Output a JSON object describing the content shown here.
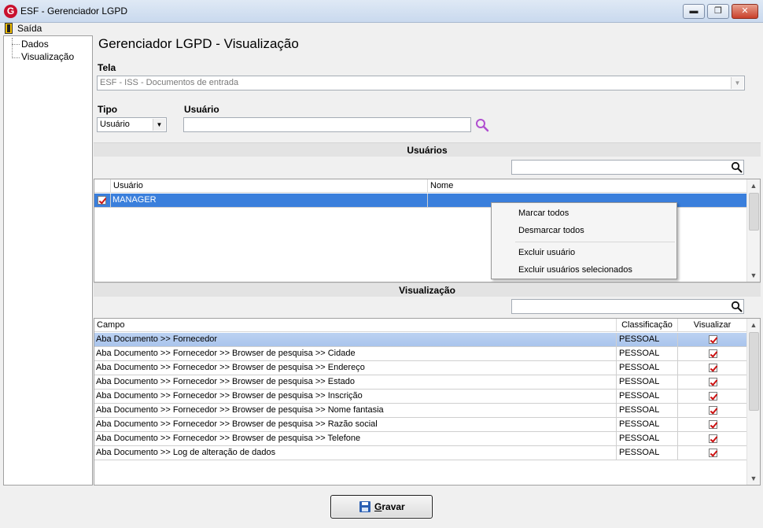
{
  "window": {
    "title": "ESF - Gerenciador LGPD",
    "icon_letter": "G",
    "min_glyph": "▬",
    "max_glyph": "❐",
    "close_glyph": "✕"
  },
  "menu": {
    "exit_label": "Saída"
  },
  "tree": {
    "items": [
      {
        "label": "Dados"
      },
      {
        "label": "Visualização"
      }
    ]
  },
  "header": {
    "title": "Gerenciador LGPD - Visualização"
  },
  "tela": {
    "label": "Tela",
    "value": "ESF - ISS - Documentos de entrada"
  },
  "tipo": {
    "label": "Tipo",
    "value": "Usuário"
  },
  "usuario": {
    "label": "Usuário",
    "value": ""
  },
  "users_section": {
    "title": "Usuários",
    "search_value": "",
    "columns": [
      "Usuário",
      "Nome"
    ],
    "rows": [
      {
        "checked": true,
        "usuario": "MANAGER",
        "nome": ""
      }
    ]
  },
  "context_menu": {
    "items": [
      "Marcar todos",
      "Desmarcar todos",
      "Excluir usuário",
      "Excluir usuários selecionados"
    ]
  },
  "visual_section": {
    "title": "Visualização",
    "search_value": "",
    "columns": [
      "Campo",
      "Classificação",
      "Visualizar"
    ],
    "rows": [
      {
        "campo": "Aba Documento >> Fornecedor",
        "classificacao": "PESSOAL",
        "visualizar": true
      },
      {
        "campo": "Aba Documento >> Fornecedor >> Browser de pesquisa >> Cidade",
        "classificacao": "PESSOAL",
        "visualizar": true
      },
      {
        "campo": "Aba Documento >> Fornecedor >> Browser de pesquisa >> Endereço",
        "classificacao": "PESSOAL",
        "visualizar": true
      },
      {
        "campo": "Aba Documento >> Fornecedor >> Browser de pesquisa >> Estado",
        "classificacao": "PESSOAL",
        "visualizar": true
      },
      {
        "campo": "Aba Documento >> Fornecedor >> Browser de pesquisa >> Inscrição",
        "classificacao": "PESSOAL",
        "visualizar": true
      },
      {
        "campo": "Aba Documento >> Fornecedor >> Browser de pesquisa >> Nome fantasia",
        "classificacao": "PESSOAL",
        "visualizar": true
      },
      {
        "campo": "Aba Documento >> Fornecedor >> Browser de pesquisa >> Razão social",
        "classificacao": "PESSOAL",
        "visualizar": true
      },
      {
        "campo": "Aba Documento >> Fornecedor >> Browser de pesquisa >> Telefone",
        "classificacao": "PESSOAL",
        "visualizar": true
      },
      {
        "campo": "Aba Documento >> Log de alteração de dados",
        "classificacao": "PESSOAL",
        "visualizar": true
      }
    ]
  },
  "actions": {
    "save_label": "Gravar"
  },
  "colors": {
    "selection": "#3a7fdc",
    "check": "#cc1111",
    "search_accent": "#b04fd0"
  }
}
